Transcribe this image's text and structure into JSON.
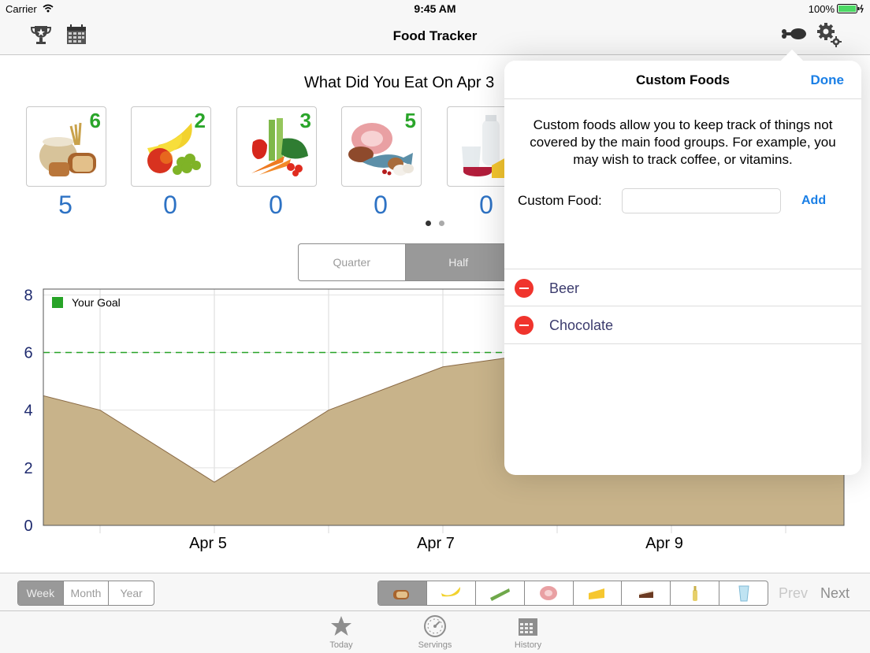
{
  "status_bar": {
    "carrier": "Carrier",
    "time": "9:45 AM",
    "battery": "100%"
  },
  "nav": {
    "title": "Food Tracker"
  },
  "main": {
    "heading": "What Did You Eat On Apr 3",
    "food_groups": [
      {
        "name": "grains-icon",
        "count": "6",
        "total": "5"
      },
      {
        "name": "fruits-icon",
        "count": "2",
        "total": "0"
      },
      {
        "name": "vegetables-icon",
        "count": "3",
        "total": "0"
      },
      {
        "name": "protein-icon",
        "count": "5",
        "total": "0"
      },
      {
        "name": "dairy-icon",
        "count": "",
        "total": "0"
      }
    ],
    "range_segments": [
      "Quarter",
      "Half"
    ],
    "legend": "Your Goal"
  },
  "chart_data": {
    "type": "area",
    "x": [
      "Apr 4",
      "Apr 4.5",
      "Apr 5",
      "Apr 6",
      "Apr 7",
      "Apr 7.5"
    ],
    "xticks": [
      "Apr 5",
      "Apr 7",
      "Apr 9"
    ],
    "y": [
      4.5,
      4.0,
      1.5,
      4.0,
      5.5,
      5.8
    ],
    "goal": 6,
    "yticks": [
      "0",
      "2",
      "4",
      "6",
      "8"
    ],
    "ylim": [
      0,
      8.2
    ],
    "legend": "Your Goal",
    "colors": {
      "fill": "#c8b38a",
      "line": "#8a6a45",
      "goal": "#27a327"
    }
  },
  "popover": {
    "title": "Custom Foods",
    "done": "Done",
    "description": "Custom foods allow you to keep track of things not covered by the main food groups. For example, you may wish to track coffee, or vitamins.",
    "field_label": "Custom Food:",
    "field_value": "",
    "add": "Add",
    "items": [
      "Beer",
      "Chocolate"
    ]
  },
  "bottom": {
    "period_segments": [
      "Week",
      "Month",
      "Year"
    ],
    "prev": "Prev",
    "next": "Next"
  },
  "tabs": [
    "Today",
    "Servings",
    "History"
  ],
  "colors": {
    "accent": "#1a7fe6",
    "count_green": "#2aa52a",
    "total_blue": "#2d72c4"
  }
}
